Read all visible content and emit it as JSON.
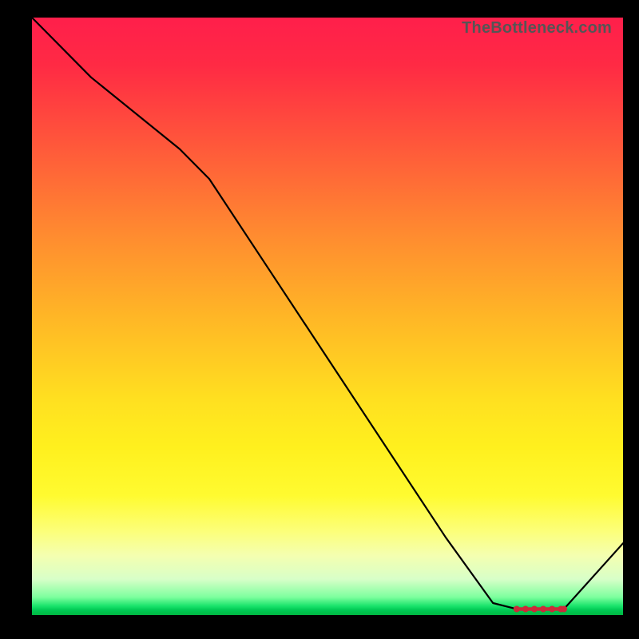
{
  "watermark": "TheBottleneck.com",
  "chart_data": {
    "type": "line",
    "title": "",
    "xlabel": "",
    "ylabel": "",
    "xlim": [
      0,
      100
    ],
    "ylim": [
      0,
      100
    ],
    "series": [
      {
        "name": "curve",
        "x": [
          0,
          10,
          25,
          30,
          40,
          50,
          60,
          70,
          78,
          82,
          85,
          88,
          90,
          100
        ],
        "y": [
          100,
          90,
          78,
          73,
          58,
          43,
          28,
          13,
          2,
          1,
          1,
          1,
          1,
          12
        ]
      }
    ],
    "flat_segment": {
      "x_start": 82,
      "x_end": 90,
      "y": 1
    },
    "flat_markers_x": [
      82,
      83.5,
      85,
      86.5,
      88,
      89.5,
      90
    ],
    "gradient_stops": [
      {
        "pos": 0,
        "color": "#ff1f4b"
      },
      {
        "pos": 0.5,
        "color": "#ffe020"
      },
      {
        "pos": 0.9,
        "color": "#f4ffb0"
      },
      {
        "pos": 1.0,
        "color": "#00b843"
      }
    ]
  }
}
